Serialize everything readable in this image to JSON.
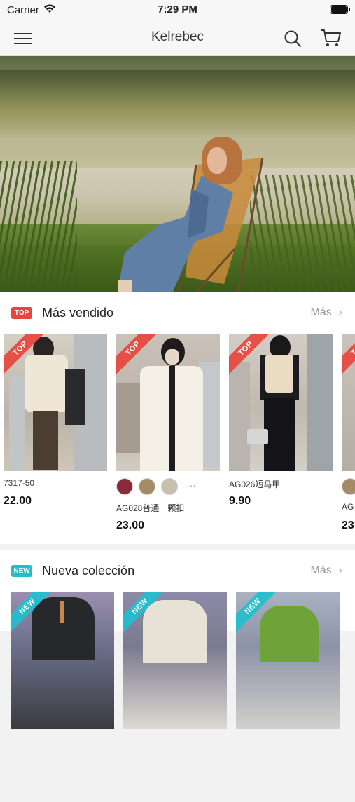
{
  "status": {
    "carrier": "Carrier",
    "time": "7:29 PM"
  },
  "nav": {
    "title": "Kelrebec"
  },
  "bestsellers": {
    "badge": "TOP",
    "title": "Más vendido",
    "more": "Más",
    "products": [
      {
        "name": "7317-50",
        "price": "22.00",
        "ribbon": "TOP"
      },
      {
        "name": "AG028普通一颗扣",
        "price": "23.00",
        "ribbon": "TOP",
        "swatch_colors": [
          "#8a2a3a",
          "#a58a66",
          "#c9bfae"
        ],
        "more_swatches": "···"
      },
      {
        "name": "AG026短马甲",
        "price": "9.90",
        "ribbon": "TOP"
      },
      {
        "name": "AG",
        "price": "23",
        "ribbon": "TOP"
      }
    ]
  },
  "new_collection": {
    "badge": "NEW",
    "title": "Nueva colección",
    "more": "Más",
    "products": [
      {
        "ribbon": "NEW"
      },
      {
        "ribbon": "NEW"
      },
      {
        "ribbon": "NEW"
      }
    ]
  },
  "colors": {
    "top_red": "#e8453c",
    "new_cyan": "#1fbfd0"
  },
  "icons": {
    "menu": "hamburger-menu-icon",
    "search": "search-icon",
    "cart": "cart-icon",
    "wifi": "wifi-icon",
    "battery": "battery-icon",
    "chevron": "chevron-right-icon"
  }
}
